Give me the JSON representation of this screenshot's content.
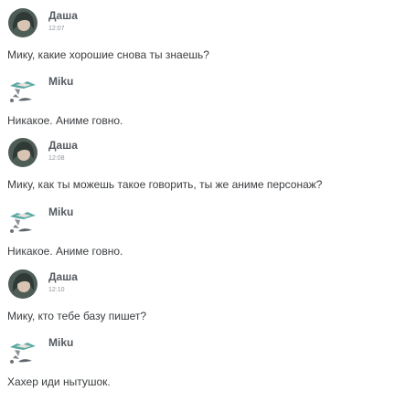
{
  "messages": [
    {
      "author": "Даша",
      "time": "12:07",
      "text": "Мику, какие хорошие снова ты знаешь?",
      "avatar": "girl-avatar-icon"
    },
    {
      "author": "Miku",
      "time": "",
      "text": "Никакое. Аниме говно.",
      "avatar": "miku-avatar-icon"
    },
    {
      "author": "Даша",
      "time": "12:08",
      "text": "Мику, как ты можешь такое говорить, ты же аниме персонаж?",
      "avatar": "girl-avatar-icon"
    },
    {
      "author": "Miku",
      "time": "",
      "text": "Никакое. Аниме говно.",
      "avatar": "miku-avatar-icon"
    },
    {
      "author": "Даша",
      "time": "12:10",
      "text": "Мику, кто тебе базу пишет?",
      "avatar": "girl-avatar-icon"
    },
    {
      "author": "Miku",
      "time": "",
      "text": "Хахер иди нытушок.",
      "avatar": "miku-avatar-icon"
    }
  ]
}
